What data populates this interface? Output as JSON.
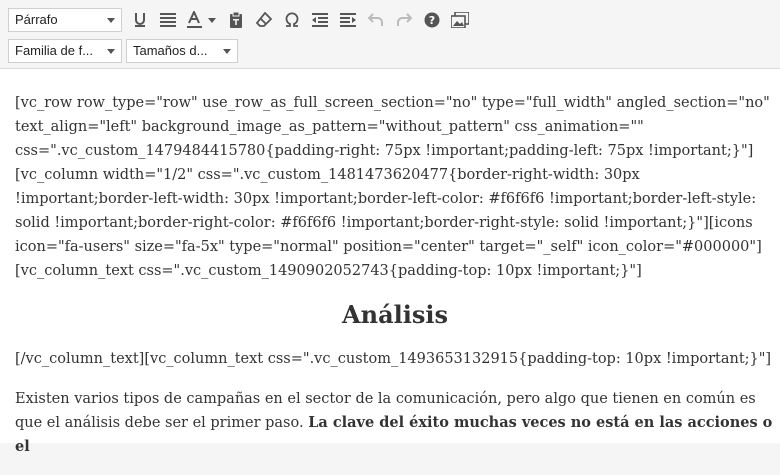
{
  "toolbar": {
    "format_select": "Párrafo",
    "font_family_select": "Familia de f...",
    "font_size_select": "Tamaños d...",
    "buttons": [
      "underline-icon",
      "justify-icon",
      "text-color-icon",
      "paste-text-icon",
      "clear-format-icon",
      "omega-icon",
      "outdent-icon",
      "indent-icon",
      "undo-icon",
      "redo-icon",
      "help-icon",
      "media-icon"
    ]
  },
  "content": {
    "para1": "[vc_row row_type=\"row\" use_row_as_full_screen_section=\"no\" type=\"full_width\" angled_section=\"no\" text_align=\"left\" background_image_as_pattern=\"without_pattern\" css_animation=\"\" css=\".vc_custom_1479484415780{padding-right: 75px !important;padding-left: 75px !important;}\"][vc_column width=\"1/2\" css=\".vc_custom_1481473620477{border-right-width: 30px !important;border-left-width: 30px !important;border-left-color: #f6f6f6 !important;border-left-style: solid !important;border-right-color: #f6f6f6 !important;border-right-style: solid !important;}\"][icons icon=\"fa-users\" size=\"fa-5x\" type=\"normal\" position=\"center\" target=\"_self\" icon_color=\"#000000\"][vc_column_text css=\".vc_custom_1490902052743{padding-top: 10px !important;}\"]",
    "heading": "Análisis",
    "para2": "[/vc_column_text][vc_column_text css=\".vc_custom_1493653132915{padding-top: 10px !important;}\"]",
    "para3_normal": "Existen varios tipos de campañas en el sector de la comunicación, pero algo que tienen en común es que el análisis debe ser el primer paso. ",
    "para3_bold": "La clave del éxito muchas veces no está en las acciones o el"
  }
}
